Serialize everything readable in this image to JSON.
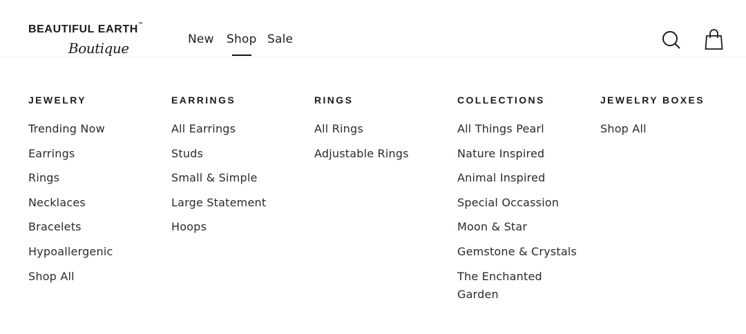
{
  "brand": {
    "name": "BEAUTIFUL EARTH",
    "tm": "™",
    "script": "Boutique"
  },
  "nav": [
    {
      "label": "New"
    },
    {
      "label": "Shop"
    },
    {
      "label": "Sale"
    }
  ],
  "header_icons": [
    "search-icon",
    "bag-icon"
  ],
  "menu": {
    "columns": [
      {
        "title": "JEWELRY",
        "links": [
          "Trending Now",
          "Earrings",
          "Rings",
          "Necklaces",
          "Bracelets",
          "Hypoallergenic",
          "Shop All"
        ]
      },
      {
        "title": "EARRINGS",
        "links": [
          "All Earrings",
          "Studs",
          "Small & Simple",
          "Large Statement",
          "Hoops"
        ]
      },
      {
        "title": "RINGS",
        "links": [
          "All Rings",
          "Adjustable Rings"
        ]
      },
      {
        "title": "COLLECTIONS",
        "links": [
          "All Things Pearl",
          "Nature Inspired",
          "Animal Inspired",
          "Special Occassion",
          "Moon & Star",
          "Gemstone & Crystals",
          "The Enchanted Garden"
        ]
      },
      {
        "title": "JEWELRY BOXES",
        "links": [
          "Shop All"
        ]
      }
    ]
  },
  "colors": {
    "text": "#1c1c1c",
    "background": "#ffffff",
    "divider": "#f4f4f4"
  }
}
